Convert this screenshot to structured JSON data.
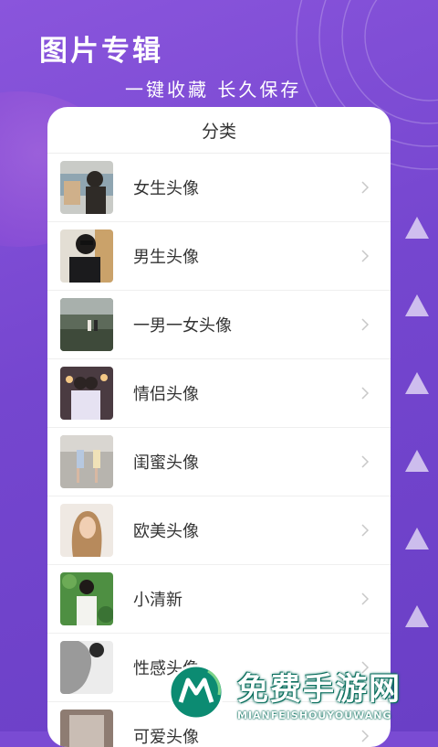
{
  "header": {
    "title": "图片专辑",
    "subtitle": "一键收藏  长久保存"
  },
  "card": {
    "title": "分类",
    "items": [
      {
        "label": "女生头像"
      },
      {
        "label": "男生头像"
      },
      {
        "label": "一男一女头像"
      },
      {
        "label": "情侣头像"
      },
      {
        "label": "闺蜜头像"
      },
      {
        "label": "欧美头像"
      },
      {
        "label": "小清新"
      },
      {
        "label": "性感头像"
      },
      {
        "label": "可爱头像"
      }
    ]
  },
  "watermark": {
    "name": "免费手游网",
    "domain": "MIANFEISHOUYOUWANG"
  },
  "colors": {
    "background": "#7a4bd3",
    "card": "#ffffff",
    "watermark_green": "#0a6e5d"
  }
}
